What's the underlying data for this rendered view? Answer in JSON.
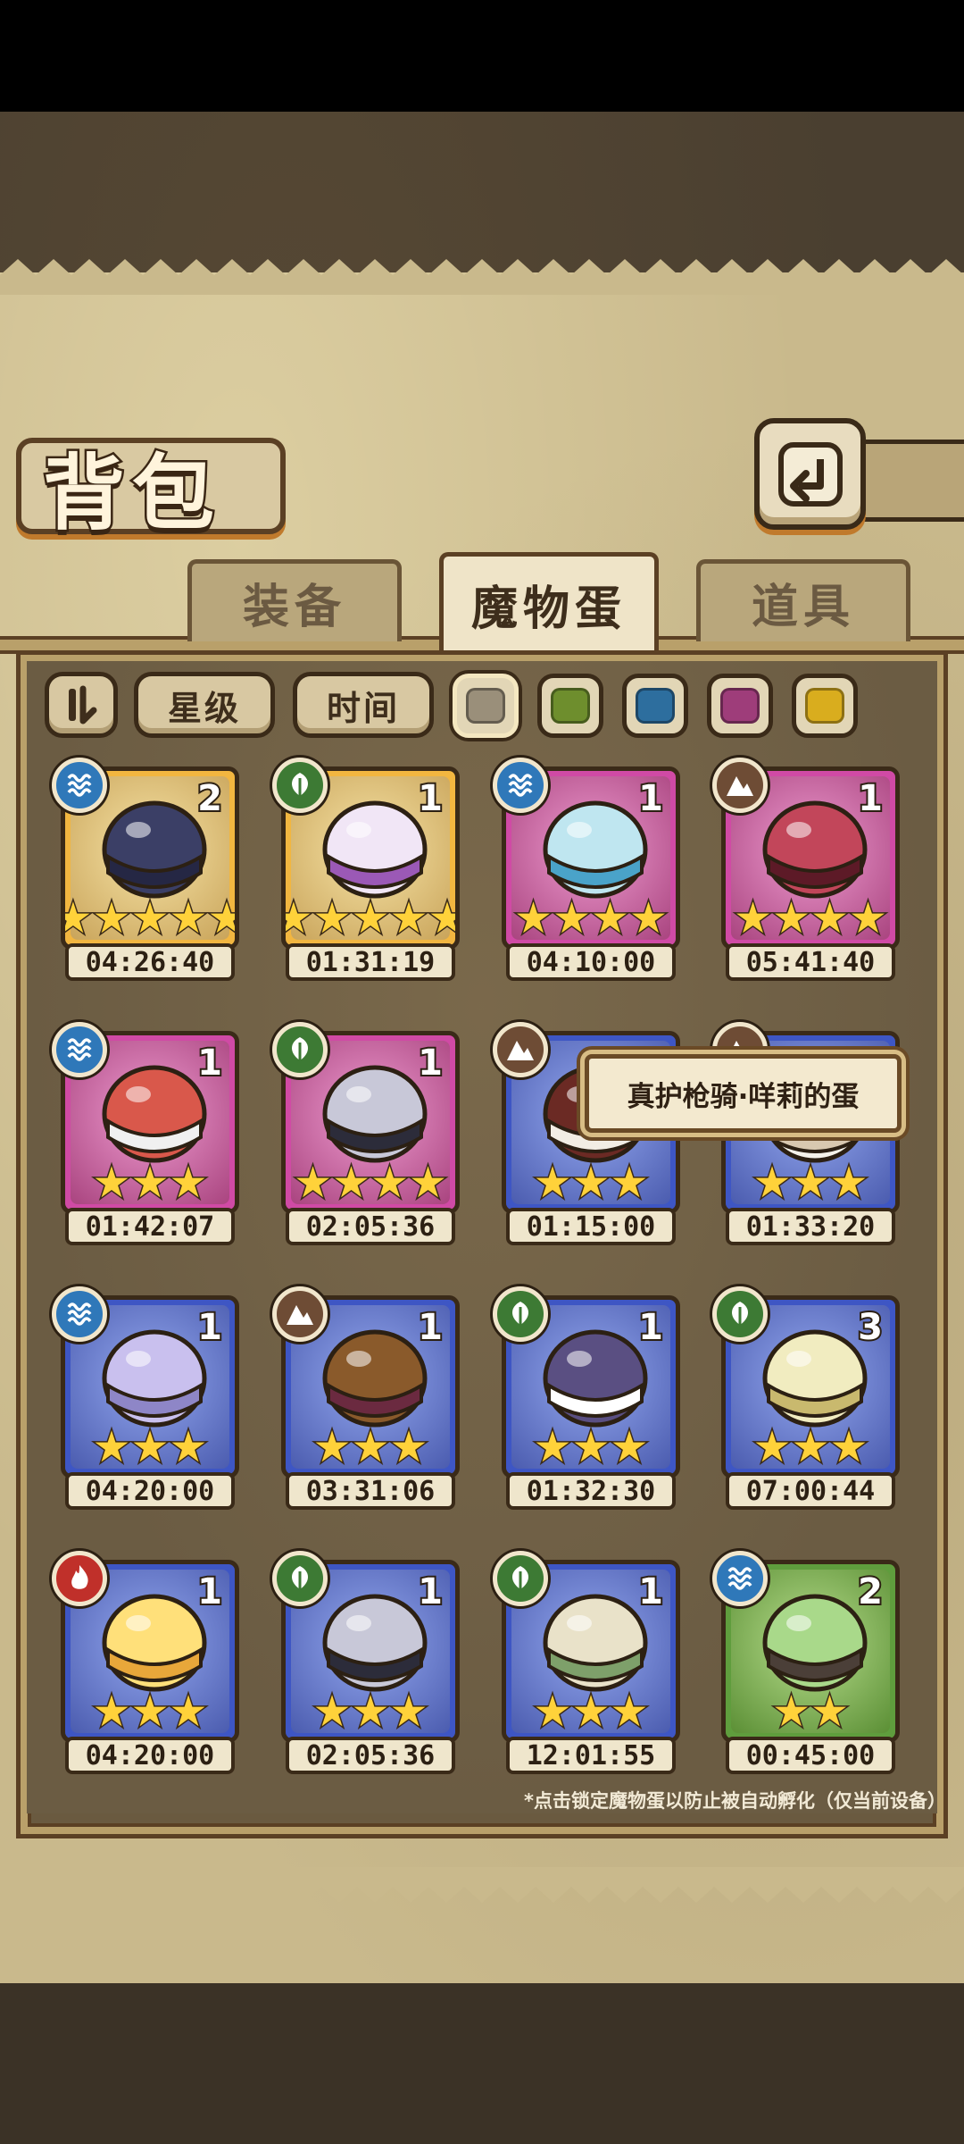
{
  "header": {
    "title": "背包"
  },
  "tabs": [
    {
      "label": "装备",
      "active": false
    },
    {
      "label": "魔物蛋",
      "active": true
    },
    {
      "label": "道具",
      "active": false
    }
  ],
  "filters": {
    "star_label": "星级",
    "time_label": "时间"
  },
  "swatch_colors": [
    "#9a8f7a",
    "#6e8e2d",
    "#2d6e9e",
    "#9e3d7a",
    "#d9ad1e"
  ],
  "eggs": [
    {
      "element": "water",
      "rarity": "gold",
      "count": "2",
      "stars": "★★★★★",
      "timer": "04:26:40",
      "icon": "dark-feather-egg"
    },
    {
      "element": "leaf",
      "rarity": "gold",
      "count": "1",
      "stars": "★★★★★",
      "timer": "01:31:19",
      "icon": "spotted-purple-egg"
    },
    {
      "element": "water",
      "rarity": "purple",
      "count": "1",
      "stars": "★★★★",
      "timer": "04:10:00",
      "icon": "water-drop-egg"
    },
    {
      "element": "earth",
      "rarity": "purple",
      "count": "1",
      "stars": "★★★★",
      "timer": "05:41:40",
      "icon": "thorn-red-egg"
    },
    {
      "element": "water",
      "rarity": "purple",
      "count": "1",
      "stars": "★★★",
      "timer": "01:42:07",
      "icon": "feather-red-egg"
    },
    {
      "element": "leaf",
      "rarity": "purple",
      "count": "1",
      "stars": "★★★★",
      "timer": "02:05:36",
      "icon": "spiked-collar-egg"
    },
    {
      "element": "earth",
      "rarity": "blue",
      "count": "",
      "stars": "★★★",
      "timer": "01:15:00",
      "icon": "skull-egg"
    },
    {
      "element": "earth",
      "rarity": "blue",
      "count": "",
      "stars": "★★★",
      "timer": "01:33:20",
      "icon": "cloud-egg"
    },
    {
      "element": "water",
      "rarity": "blue",
      "count": "1",
      "stars": "★★★",
      "timer": "04:20:00",
      "icon": "jelly-egg"
    },
    {
      "element": "earth",
      "rarity": "blue",
      "count": "1",
      "stars": "★★★",
      "timer": "03:31:06",
      "icon": "basket-egg"
    },
    {
      "element": "leaf",
      "rarity": "blue",
      "count": "1",
      "stars": "★★★",
      "timer": "01:32:30",
      "icon": "fur-egg"
    },
    {
      "element": "leaf",
      "rarity": "blue",
      "count": "3",
      "stars": "★★★",
      "timer": "07:00:44",
      "icon": "bud-egg"
    },
    {
      "element": "fire",
      "rarity": "blue",
      "count": "1",
      "stars": "★★★",
      "timer": "04:20:00",
      "icon": "lightning-egg"
    },
    {
      "element": "leaf",
      "rarity": "blue",
      "count": "1",
      "stars": "★★★",
      "timer": "02:05:36",
      "icon": "spiked-collar-egg"
    },
    {
      "element": "leaf",
      "rarity": "blue",
      "count": "1",
      "stars": "★★★",
      "timer": "12:01:55",
      "icon": "leaf-wrapped-egg"
    },
    {
      "element": "water",
      "rarity": "green",
      "count": "2",
      "stars": "★★",
      "timer": "00:45:00",
      "icon": "green-cloak-egg"
    }
  ],
  "tooltip": "真护枪骑·咩莉的蛋",
  "footnote": "*点击锁定魔物蛋以防止被自动孵化（仅当前设备）"
}
